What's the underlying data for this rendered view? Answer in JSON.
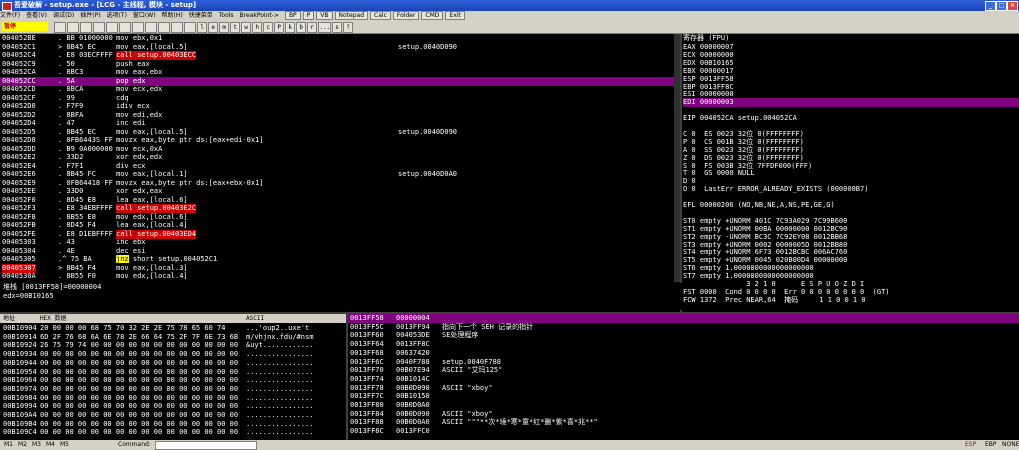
{
  "window": {
    "title": "吾爱破解 - setup.exe - [LCG - 主线程, 模块 - setup]",
    "min": "_",
    "max": "□",
    "close": "×"
  },
  "menu": {
    "items": [
      "文件(F)",
      "查看(V)",
      "调试(D)",
      "插件(P)",
      "选项(T)",
      "窗口(W)",
      "帮助(H)",
      "快捷菜单",
      "Tools",
      "BreakPoint->"
    ],
    "tools": [
      "BP",
      "P",
      "VB",
      "Notepad",
      "Calc",
      "Folder",
      "CMD",
      "Exit"
    ]
  },
  "toolbar": {
    "state": "暂停",
    "buttons": [
      "l",
      "e",
      "m",
      "t",
      "w",
      "h",
      "c",
      "P",
      "k",
      "b",
      "r",
      "...",
      "s",
      "?"
    ]
  },
  "disasm": {
    "rows": [
      {
        "addr": "004052BE",
        "bytes": ". BB 01000000",
        "asm": "mov ebx,0x1",
        "cmt": ""
      },
      {
        "addr": "004052C1",
        "bytes": "> 8B45 EC",
        "asm": "mov eax,[local.5]",
        "cmt": "setup.0040D090"
      },
      {
        "addr": "004052C4",
        "bytes": ". E8 03ECFFFF",
        "asm": "call setup.00403ECC",
        "cmt": "",
        "call": true
      },
      {
        "addr": "004052C9",
        "bytes": ". 50",
        "asm": "push eax",
        "cmt": ""
      },
      {
        "addr": "004052CA",
        "bytes": ". 8BC3",
        "asm": "mov eax,ebx",
        "cmt": ""
      },
      {
        "addr": "004052CC",
        "bytes": ". 5A",
        "asm": "pop edx",
        "cmt": "",
        "hl": true
      },
      {
        "addr": "004052CD",
        "bytes": ". 8BCA",
        "asm": "mov ecx,edx",
        "cmt": ""
      },
      {
        "addr": "004052CF",
        "bytes": ". 99",
        "asm": "cdq",
        "cmt": ""
      },
      {
        "addr": "004052D0",
        "bytes": ". F7F9",
        "asm": "idiv ecx",
        "cmt": ""
      },
      {
        "addr": "004052D2",
        "bytes": ". 8BFA",
        "asm": "mov edi,edx",
        "cmt": ""
      },
      {
        "addr": "004052D4",
        "bytes": ". 47",
        "asm": "inc edi",
        "cmt": ""
      },
      {
        "addr": "004052D5",
        "bytes": ". 8B45 EC",
        "asm": "mov eax,[local.5]",
        "cmt": "setup.0040D090"
      },
      {
        "addr": "004052D8",
        "bytes": ". 0FB6443S FF",
        "asm": "movzx eax,byte ptr ds:[eax+edi-0x1]",
        "cmt": ""
      },
      {
        "addr": "004052DD",
        "bytes": ". B9 0A000000",
        "asm": "mov ecx,0xA",
        "cmt": ""
      },
      {
        "addr": "004052E2",
        "bytes": ". 33D2",
        "asm": "xor edx,edx",
        "cmt": ""
      },
      {
        "addr": "004052E4",
        "bytes": ". F7F1",
        "asm": "div ecx",
        "cmt": ""
      },
      {
        "addr": "004052E6",
        "bytes": ". 8B45 FC",
        "asm": "mov eax,[local.1]",
        "cmt": "setup.0040D0A0"
      },
      {
        "addr": "004052E9",
        "bytes": ". 0FB64418 FF",
        "asm": "movzx eax,byte ptr ds:[eax+ebx-0x1]",
        "cmt": ""
      },
      {
        "addr": "004052EE",
        "bytes": ". 33D0",
        "asm": "xor edx,eax",
        "cmt": ""
      },
      {
        "addr": "004052F0",
        "bytes": ". 8D45 E8",
        "asm": "lea eax,[local.6]",
        "cmt": ""
      },
      {
        "addr": "004052F3",
        "bytes": ". E8 34EBFFFF",
        "asm": "call setup.00403E2C",
        "cmt": "",
        "call": true
      },
      {
        "addr": "004052F8",
        "bytes": ". 8B55 E8",
        "asm": "mov edx,[local.6]",
        "cmt": ""
      },
      {
        "addr": "004052FB",
        "bytes": ". 8D45 F4",
        "asm": "lea eax,[local.4]",
        "cmt": ""
      },
      {
        "addr": "004052FE",
        "bytes": ". E8 D1EBFFFF",
        "asm": "call setup.00403ED4",
        "cmt": "",
        "call": true
      },
      {
        "addr": "00405303",
        "bytes": ". 43",
        "asm": "inc ebx",
        "cmt": ""
      },
      {
        "addr": "00405304",
        "bytes": ". 4E",
        "asm": "dec esi",
        "cmt": ""
      },
      {
        "addr": "00405305",
        "bytes": ".^ 75 BA",
        "asm": "short setup.004052C1",
        "kw": "jnz",
        "cmt": "",
        "jmp": true
      },
      {
        "addr": "00405307",
        "bytes": "> 8B45 F4",
        "asm": "mov eax,[local.3]",
        "cmt": "",
        "cur": true
      },
      {
        "addr": "0040530A",
        "bytes": ". 8B55 F0",
        "asm": "mov edx,[local.4]",
        "cmt": ""
      }
    ]
  },
  "info": {
    "line1": "堆栈 [0013FF58]=00000004",
    "line2": "edx=00B10165"
  },
  "regs": {
    "header": "寄存器 (FPU)",
    "lines": [
      "EAX 00000007",
      "ECX 00000000",
      "EDX 00B10165",
      "EBX 00000017",
      "ESP 0013FF58",
      "EBP 0013FF8C",
      "ESI 00000000",
      "EDI 00000003",
      "",
      "EIP 004052CA setup.004052CA",
      "",
      "C 0  ES 0023 32位 0(FFFFFFFF)",
      "P 0  CS 001B 32位 0(FFFFFFFF)",
      "A 0  SS 0023 32位 0(FFFFFFFF)",
      "Z 0  DS 0023 32位 0(FFFFFFFF)",
      "S 0  FS 003B 32位 7FFDF000(FFF)",
      "T 0  GS 0000 NULL",
      "D 0",
      "O 0  LastErr ERROR_ALREADY_EXISTS (000000B7)",
      "",
      "EFL 00000206 (NO,NB,NE,A,NS,PE,GE,G)",
      "",
      "ST0 empty +UNORM 401C 7C93A029 7C99B600",
      "ST1 empty +UNORM 00BA 00000000 0012BC90",
      "ST2 empty -UNORM BC3C 7C92EY08 0012BB68",
      "ST3 empty +UNORM 0002 0000005D 0012BB80",
      "ST4 empty +UNORM 6F73 0012BCBC 006AC760",
      "ST5 empty +UNORM 0045 020B00D4 00000000",
      "ST6 empty 1.0000000000000000000",
      "ST7 empty 1.0000000000000000000",
      "               3 2 1 0      E S P U O Z D I",
      "FST 0000  Cond 0 0 0 0  Err 0 0 0 0 0 0 0 0  (GT)",
      "FCW 1372  Prec NEAR,64  掩码     1 1 0 0 1 0"
    ]
  },
  "dump": {
    "headers": [
      "地址",
      "HEX 数据",
      "ASCII"
    ],
    "rows": [
      {
        "addr": "00B10904",
        "hex": "20 00 00 00 68 75 70 32 2E 2E 75 78 65 60 74",
        "ascii": "...'oup2..uxe't"
      },
      {
        "addr": "00B10914",
        "hex": "6D 2F 76 68 6A 6E 78 2E 66 64 75 2F 7F 6E 73 6B",
        "ascii": "m/vhjnx.fdu/#nsm"
      },
      {
        "addr": "00B10924",
        "hex": "26 75 79 74 00 00 00 00 00 00 00 00 00 00 00 00",
        "ascii": "&uyt............"
      },
      {
        "addr": "00B10934",
        "hex": "00 00 00 00 00 00 00 00 00 00 00 00 00 00 00 00",
        "ascii": "................"
      },
      {
        "addr": "00B10944",
        "hex": "00 00 00 00 00 00 00 00 00 00 00 00 00 00 00 00",
        "ascii": "................"
      },
      {
        "addr": "00B10954",
        "hex": "00 00 00 00 00 00 00 00 00 00 00 00 00 00 00 00",
        "ascii": "................"
      },
      {
        "addr": "00B10964",
        "hex": "00 00 00 00 00 00 00 00 00 00 00 00 00 00 00 00",
        "ascii": "................"
      },
      {
        "addr": "00B10974",
        "hex": "00 00 00 00 00 00 00 00 00 00 00 00 00 00 00 00",
        "ascii": "................"
      },
      {
        "addr": "00B10984",
        "hex": "00 00 00 00 00 00 00 00 00 00 00 00 00 00 00 00",
        "ascii": "................"
      },
      {
        "addr": "00B10994",
        "hex": "00 00 00 00 00 00 00 00 00 00 00 00 00 00 00 00",
        "ascii": "................"
      },
      {
        "addr": "00B109A4",
        "hex": "00 00 00 00 00 00 00 00 00 00 00 00 00 00 00 00",
        "ascii": "................"
      },
      {
        "addr": "00B109B4",
        "hex": "00 00 00 00 00 00 00 00 00 00 00 00 00 00 00 00",
        "ascii": "................"
      },
      {
        "addr": "00B109C4",
        "hex": "00 00 00 00 00 00 00 00 00 00 00 00 00 00 00 00",
        "ascii": "................"
      }
    ]
  },
  "stack": {
    "rows": [
      {
        "addr": "0013FF58",
        "val": "00000004",
        "cmt": "",
        "hl": true
      },
      {
        "addr": "0013FF5C",
        "val": "0013FF94",
        "cmt": "指向下一个 SEH 记录的指针"
      },
      {
        "addr": "0013FF60",
        "val": "004053DE",
        "cmt": "SE处理程序"
      },
      {
        "addr": "0013FF64",
        "val": "0013FF8C",
        "cmt": ""
      },
      {
        "addr": "0013FF68",
        "val": "00637420",
        "cmt": ""
      },
      {
        "addr": "0013FF6C",
        "val": "0040F788",
        "cmt": "setup.0040F788"
      },
      {
        "addr": "0013FF70",
        "val": "00B07E94",
        "cmt": "ASCII \"艾玛125\""
      },
      {
        "addr": "0013FF74",
        "val": "00B1014C",
        "cmt": ""
      },
      {
        "addr": "0013FF78",
        "val": "00B0D090",
        "cmt": "ASCII \"xboy\""
      },
      {
        "addr": "0013FF7C",
        "val": "00B10150",
        "cmt": ""
      },
      {
        "addr": "0013FF80",
        "val": "00B0D0A0",
        "cmt": ""
      },
      {
        "addr": "0013FF84",
        "val": "00B0D090",
        "cmt": "ASCII \"xboy\""
      },
      {
        "addr": "0013FF88",
        "val": "00B0D0A0",
        "cmt": "ASCII \"\"\"**次*境*寒*童*红*删*紫*喜*兆**\""
      },
      {
        "addr": "0013FF8C",
        "val": "0013FFC0",
        "cmt": ""
      }
    ]
  },
  "status": {
    "tabs": [
      "M1",
      "M2",
      "M3",
      "M4",
      "M5"
    ],
    "cmd_label": "Command:",
    "right1": "ESP",
    "right2": "EBP",
    "right3": "NONE"
  }
}
